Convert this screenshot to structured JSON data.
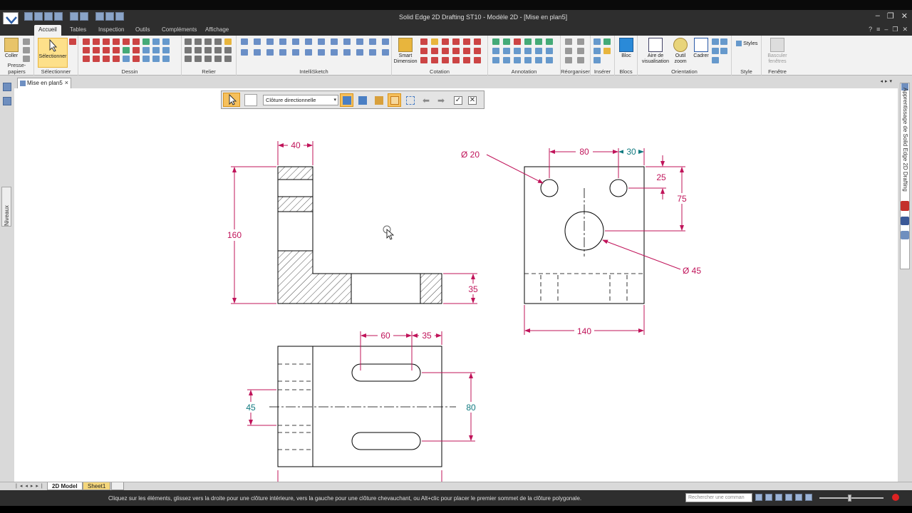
{
  "window": {
    "title": "Solid Edge 2D Drafting ST10 - Modèle 2D - [Mise en plan5]",
    "controls": [
      "–",
      "❐",
      "✕"
    ]
  },
  "ribbon": {
    "tabs": [
      "Accueil",
      "Tables",
      "Inspection",
      "Outils",
      "Compléments",
      "Affichage"
    ],
    "active_tab": "Accueil",
    "groups": {
      "presse_papiers": "Presse-papiers",
      "selectionner": "Sélectionner",
      "dessin": "Dessin",
      "relier": "Relier",
      "intellisketch": "IntelliSketch",
      "cotation": "Cotation",
      "annotation": "Annotation",
      "reorganiser": "Réorganiser",
      "inserer": "Insérer",
      "blocs": "Blocs",
      "orientation": "Orientation",
      "style": "Style",
      "fenetre": "Fenêtre"
    },
    "buttons": {
      "coller": "Coller",
      "selectionner": "Sélectionner",
      "smart_dimension_1": "Smart",
      "smart_dimension_2": "Dimension",
      "bloc": "Bloc",
      "aire_1": "Aire de",
      "aire_2": "visualisation",
      "outil_1": "Outil",
      "outil_2": "zoom",
      "cadrer": "Cadrer",
      "styles": "Styles",
      "basculer_1": "Basculer",
      "basculer_2": "fenêtres"
    }
  },
  "document_tab": {
    "label": "Mise en plan5",
    "close": "×"
  },
  "left_panel": {
    "niveaux": "Niveaux"
  },
  "right_panel": {
    "apprentissage": "Apprentissage de Solid Edge 2D Drafting"
  },
  "command_bar": {
    "dropdown_value": "Clôture directionnelle"
  },
  "drawing": {
    "dims": {
      "front_width": "40",
      "front_height": "160",
      "front_base": "35",
      "side_hole_small": "Ø 20",
      "side_spacing": "80",
      "side_edge": "30",
      "side_top": "25",
      "side_hole_height": "75",
      "side_hole_large": "Ø 45",
      "side_width": "140",
      "top_slot_len": "60",
      "top_slot_edge": "35",
      "top_left": "45",
      "top_right": "80"
    },
    "colors": {
      "dim_magenta": "#c0145a",
      "dim_teal": "#117a80",
      "line": "#000000"
    }
  },
  "sheets": {
    "tabs": [
      "2D Model",
      "Sheet1"
    ],
    "active": "2D Model"
  },
  "status": {
    "message": "Cliquez sur les éléments, glissez vers la droite pour une clôture intérieure, vers la gauche pour une clôture chevauchant, ou Alt+clic pour placer le premier sommet de la clôture polygonale.",
    "search_placeholder": "Rechercher une comman"
  }
}
